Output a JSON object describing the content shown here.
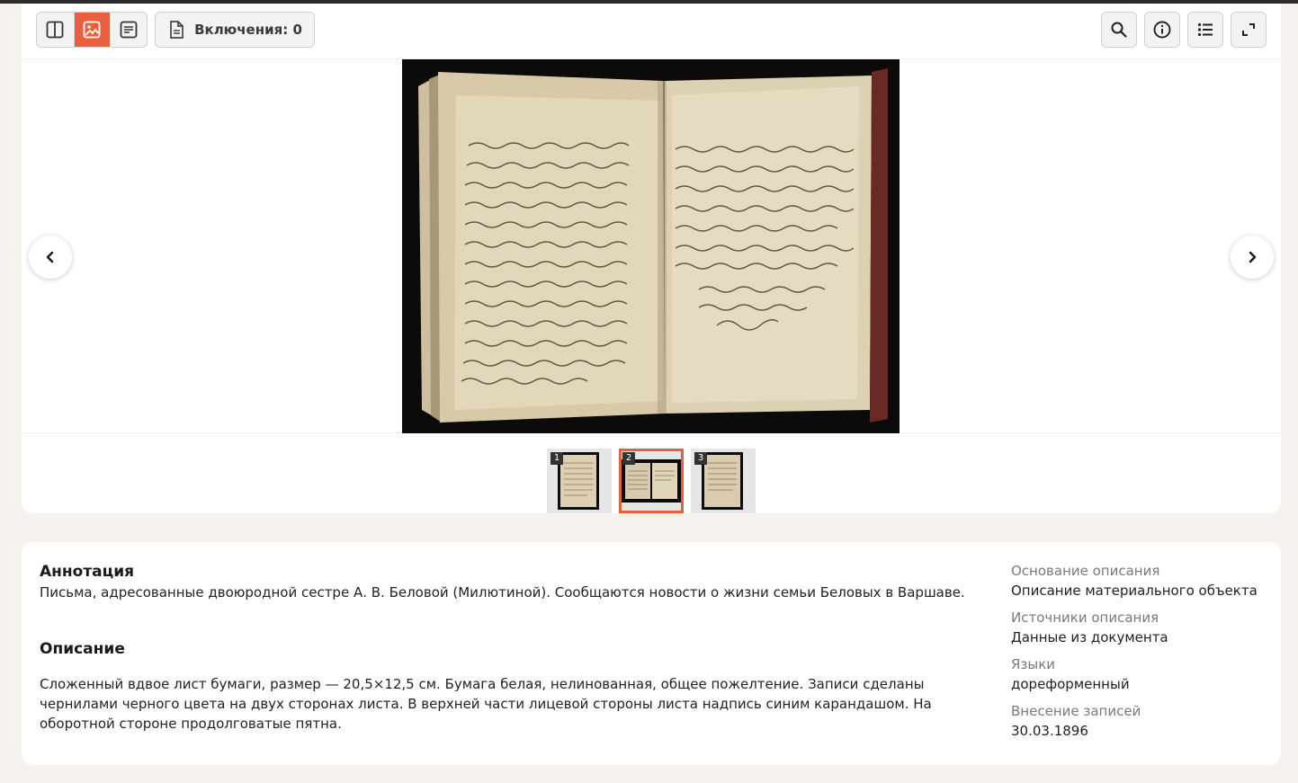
{
  "toolbar": {
    "view_modes": [
      {
        "icon": "split-view-icon",
        "active": false
      },
      {
        "icon": "image-icon",
        "active": true
      },
      {
        "icon": "text-icon",
        "active": false
      }
    ],
    "inclusions_label": "Включения: 0",
    "right_buttons": [
      "search-icon",
      "info-icon",
      "list-icon",
      "fullscreen-icon"
    ]
  },
  "viewer": {
    "prev_icon": "chevron-left-icon",
    "next_icon": "chevron-right-icon",
    "thumbnails": [
      {
        "number": "1",
        "active": false
      },
      {
        "number": "2",
        "active": true
      },
      {
        "number": "3",
        "active": false
      }
    ]
  },
  "annotation": {
    "title": "Аннотация",
    "text": "Письма, адресованные двоюродной сестре А. В. Беловой (Милютиной). Сообщаются новости о жизни семьи Беловых в Варшаве."
  },
  "description": {
    "title": "Описание",
    "text": "Сложенный вдвое лист бумаги, размер — 20,5×12,5 см. Бумага белая, нелинованная, общее пожелтение. Записи сделаны чернилами черного цвета на двух сторонах листа. В верхней части лицевой стороны листа надпись синим карандашом. На оборотной стороне продолговатые пятна."
  },
  "meta": {
    "basis_label": "Основание описания",
    "basis_value": "Описание материального объекта",
    "sources_label": "Источники описания",
    "sources_value": "Данные из документа",
    "languages_label": "Языки",
    "languages_value": "дореформенный",
    "entry_label": "Внесение записей",
    "entry_value": "30.03.1896"
  },
  "colors": {
    "accent": "#e8603c",
    "page_bg": "#f5f2ee"
  }
}
